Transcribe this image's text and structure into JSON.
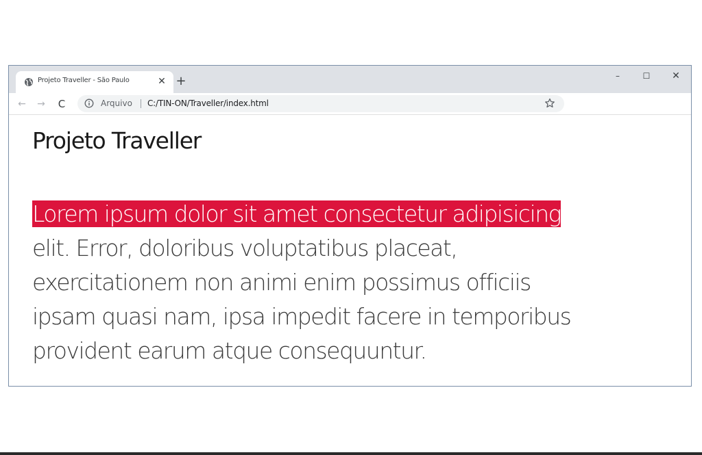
{
  "browser": {
    "tab": {
      "title": "Projeto Traveller - São Paulo",
      "close_glyph": "✕",
      "favicon": "globe-icon"
    },
    "new_tab_glyph": "+",
    "window_controls": {
      "minimize_glyph": "–",
      "maximize_glyph": "☐",
      "close_glyph": "✕"
    },
    "toolbar": {
      "back_glyph": "←",
      "forward_glyph": "→",
      "reload_glyph": "C",
      "origin_label": "Arquivo",
      "url": "C:/TIN-ON/Traveller/index.html",
      "star_icon": "bookmark-star-icon"
    }
  },
  "page": {
    "title": "Projeto Traveller",
    "paragraph_lines": [
      "Lorem ipsum dolor sit amet consectetur adipisicing",
      "elit. Error, doloribus voluptatibus placeat,",
      "exercitationem non animi enim possimus officiis",
      "ipsam quasi nam, ipsa impedit facere in temporibus",
      "provident earum atque consequuntur."
    ],
    "highlight_color": "#dc143c",
    "text_color": "#3a3a3a"
  }
}
